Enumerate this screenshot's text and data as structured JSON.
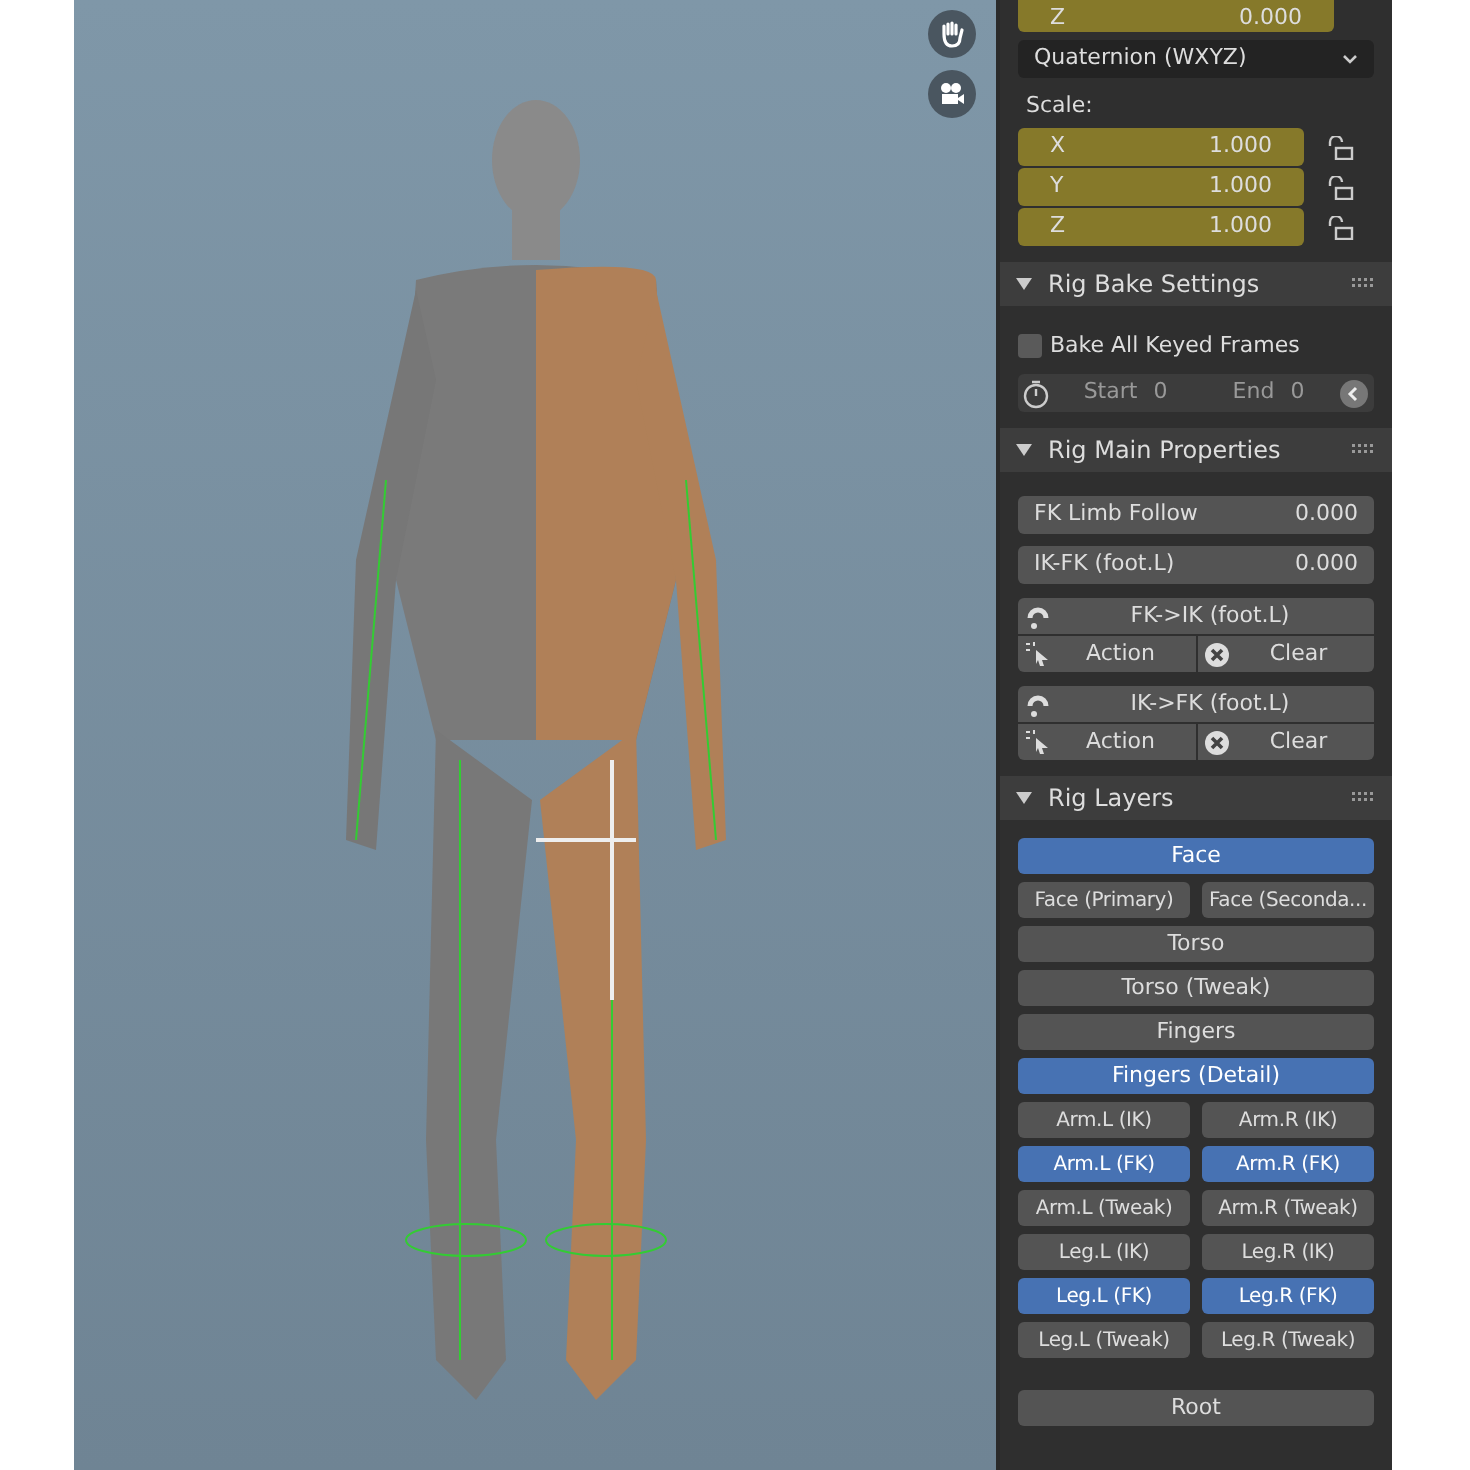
{
  "transform": {
    "rotation_last": {
      "axis": "Z",
      "value": "0.000"
    },
    "rotation_mode": "Quaternion (WXYZ)",
    "scale_label": "Scale:",
    "scale": [
      {
        "axis": "X",
        "value": "1.000",
        "locked": false
      },
      {
        "axis": "Y",
        "value": "1.000",
        "locked": false
      },
      {
        "axis": "Z",
        "value": "1.000",
        "locked": false
      }
    ]
  },
  "bake": {
    "title": "Rig Bake Settings",
    "expanded": true,
    "checkbox": {
      "label": "Bake All Keyed Frames",
      "checked": false
    },
    "start": {
      "label": "Start",
      "value": "0"
    },
    "end": {
      "label": "End",
      "value": "0"
    }
  },
  "main": {
    "title": "Rig Main Properties",
    "expanded": true,
    "fields": [
      {
        "label": "FK Limb Follow",
        "value": "0.000"
      },
      {
        "label": "IK-FK (foot.L)",
        "value": "0.000"
      }
    ],
    "snaps": [
      {
        "label": "FK->IK (foot.L)",
        "action": "Action",
        "clear": "Clear"
      },
      {
        "label": "IK->FK (foot.L)",
        "action": "Action",
        "clear": "Clear"
      }
    ]
  },
  "layers": {
    "title": "Rig Layers",
    "expanded": true,
    "rows": [
      [
        {
          "label": "Face",
          "selected": true
        }
      ],
      [
        {
          "label": "Face (Primary)",
          "selected": false
        },
        {
          "label": "Face (Seconda...",
          "selected": false
        }
      ],
      [
        {
          "label": "Torso",
          "selected": false
        }
      ],
      [
        {
          "label": "Torso (Tweak)",
          "selected": false
        }
      ],
      [
        {
          "label": "Fingers",
          "selected": false
        }
      ],
      [
        {
          "label": "Fingers (Detail)",
          "selected": true
        }
      ],
      [
        {
          "label": "Arm.L (IK)",
          "selected": false
        },
        {
          "label": "Arm.R (IK)",
          "selected": false
        }
      ],
      [
        {
          "label": "Arm.L (FK)",
          "selected": true
        },
        {
          "label": "Arm.R (FK)",
          "selected": true
        }
      ],
      [
        {
          "label": "Arm.L (Tweak)",
          "selected": false
        },
        {
          "label": "Arm.R (Tweak)",
          "selected": false
        }
      ],
      [
        {
          "label": "Leg.L (IK)",
          "selected": false
        },
        {
          "label": "Leg.R (IK)",
          "selected": false
        }
      ],
      [
        {
          "label": "Leg.L (FK)",
          "selected": true
        },
        {
          "label": "Leg.R (FK)",
          "selected": true
        }
      ],
      [
        {
          "label": "Leg.L (Tweak)",
          "selected": false
        },
        {
          "label": "Leg.R (Tweak)",
          "selected": false
        }
      ]
    ],
    "root": {
      "label": "Root",
      "selected": false
    }
  }
}
